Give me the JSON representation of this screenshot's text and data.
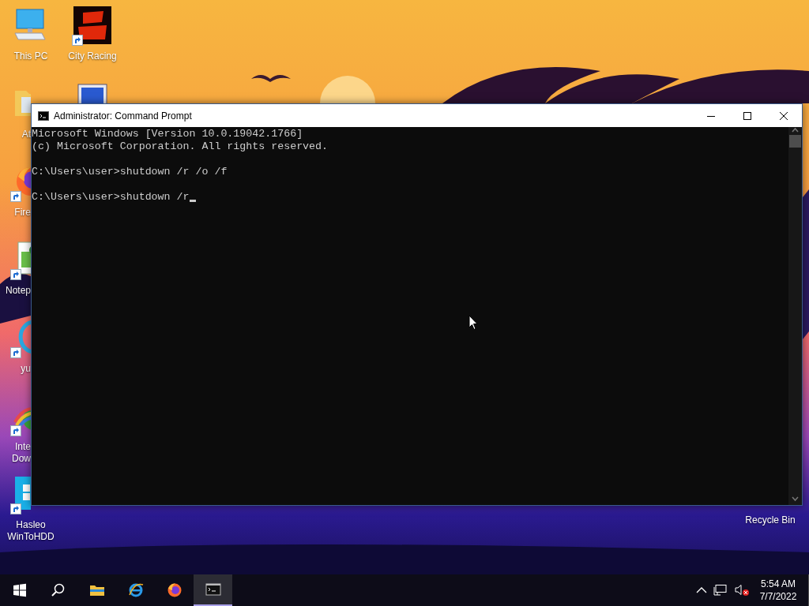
{
  "desktop": {
    "columns": [
      [
        {
          "kind": "pc",
          "label_lines": [
            "This PC"
          ],
          "shortcut": false,
          "partly_hidden": false
        },
        {
          "kind": "folder",
          "label_lines": [
            "At"
          ],
          "shortcut": false,
          "partly_hidden": true
        },
        {
          "kind": "firefox",
          "label_lines": [
            "Fire"
          ],
          "shortcut": true,
          "partly_hidden": true
        },
        {
          "kind": "notepad",
          "label_lines": [
            "Notep"
          ],
          "shortcut": true,
          "partly_hidden": true
        },
        {
          "kind": "ring",
          "label_lines": [
            "yu"
          ],
          "shortcut": true,
          "partly_hidden": true
        },
        {
          "kind": "globe",
          "label_lines": [
            "Inte",
            "Dow"
          ],
          "shortcut": true,
          "partly_hidden": true
        },
        {
          "kind": "tile",
          "label_lines": [
            "Hasleo",
            "WinToHDD"
          ],
          "shortcut": true,
          "partly_hidden": true
        }
      ],
      [
        {
          "kind": "game",
          "label_lines": [
            "City Racing"
          ],
          "shortcut": true,
          "partly_hidden": false
        },
        {
          "kind": "monitor",
          "shortcut": false,
          "partly_hidden": true
        }
      ]
    ],
    "right_icons": [
      {
        "label_lines": [
          "Recycle Bin"
        ]
      }
    ]
  },
  "window": {
    "title": "Administrator: Command Prompt",
    "console_blocks": [
      [
        "Microsoft Windows [Version 10.0.19042.1766]",
        "(c) Microsoft Corporation. All rights reserved."
      ],
      [
        "C:\\Users\\user>shutdown /r /o /f"
      ],
      [
        "C:\\Users\\user>shutdown /r"
      ]
    ],
    "text_cursor": true
  },
  "taskbar": {
    "items": [
      {
        "kind": "start",
        "selected": false
      },
      {
        "kind": "search",
        "selected": false
      },
      {
        "kind": "explorer",
        "selected": false
      },
      {
        "kind": "ie",
        "selected": false
      },
      {
        "kind": "firefox",
        "selected": false
      },
      {
        "kind": "cmd",
        "selected": true
      }
    ],
    "tray": {
      "volume_muted": true,
      "time": "5:54 AM",
      "date": "7/7/2022"
    }
  }
}
